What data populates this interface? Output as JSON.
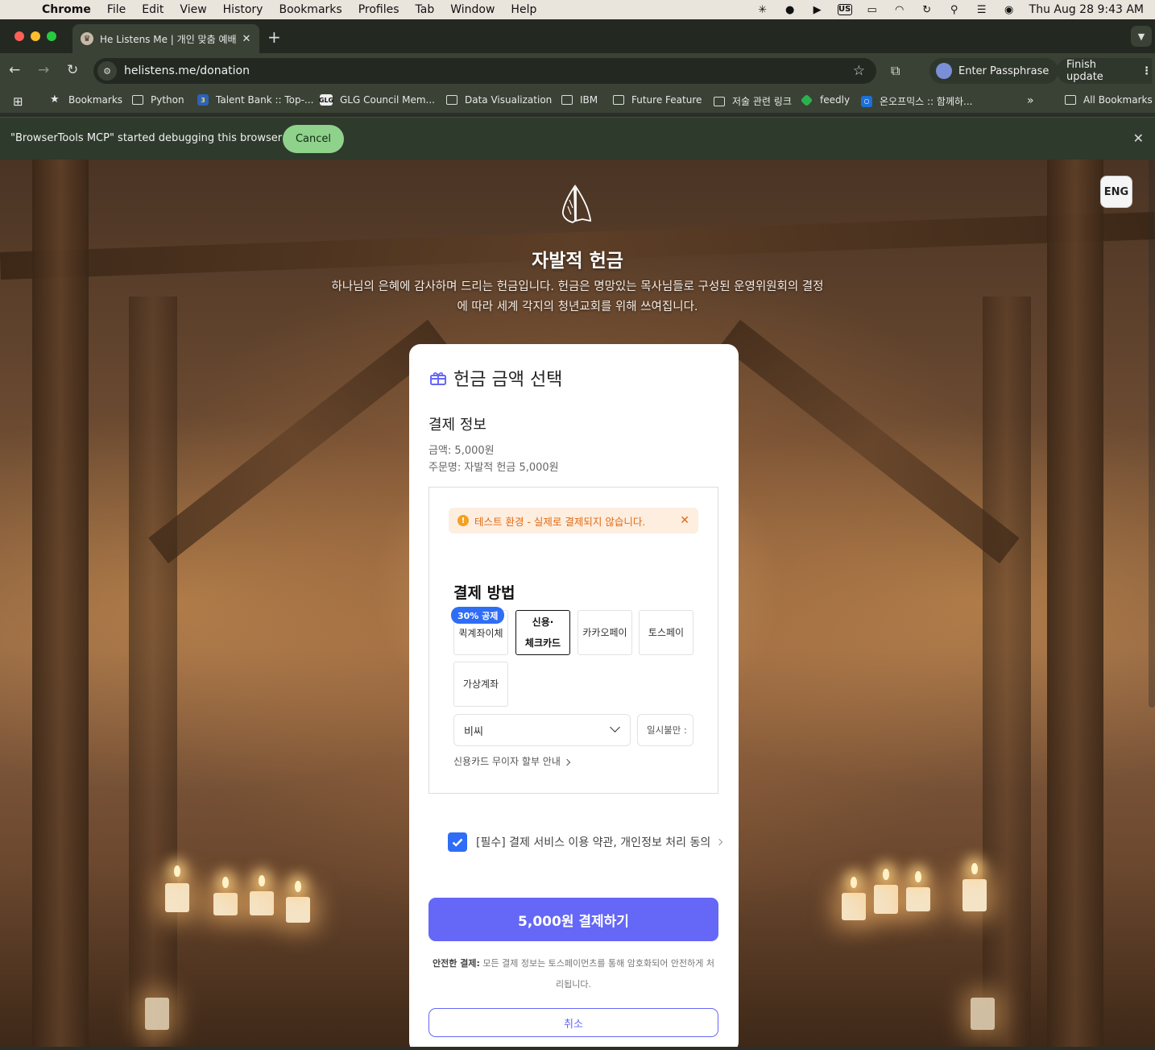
{
  "menubar": {
    "app": "Chrome",
    "items": [
      "File",
      "Edit",
      "View",
      "History",
      "Bookmarks",
      "Profiles",
      "Tab",
      "Window",
      "Help"
    ],
    "input_source": "US",
    "clock": "Thu Aug 28  9:43 AM"
  },
  "tab": {
    "title": "He Listens Me | 개인 맞춤 예배"
  },
  "toolbar": {
    "url": "helistens.me/donation",
    "passphrase_label": "Enter Passphrase",
    "finish_update_label": "Finish update"
  },
  "bookmarks": {
    "items": [
      "Bookmarks",
      "Python",
      "Talent Bank :: Top-...",
      "GLG Council Mem...",
      "Data Visualization",
      "IBM",
      "Future Feature",
      "저술 관련 링크",
      "feedly",
      "온오프믹스 :: 함께하..."
    ],
    "glg_badge": "GLG",
    "all_label": "All Bookmarks"
  },
  "infobar": {
    "message": "\"BrowserTools MCP\" started debugging this browser",
    "cancel_label": "Cancel"
  },
  "page": {
    "lang_button": "ENG",
    "title": "자발적 헌금",
    "description": "하나님의 은혜에 감사하며 드리는 헌금입니다. 헌금은 명망있는 목사님들로 구성된 운영위원회의 결정에 따라 세계 각지의 청년교회를 위해 쓰여집니다."
  },
  "card": {
    "title": "헌금 금액 선택",
    "pay_info_title": "결제 정보",
    "amount_line": "금액: 5,000원",
    "order_line": "주문명: 자발적 헌금 5,000원",
    "warning": "테스트 환경 - 실제로 결제되지 않습니다.",
    "method_title": "결제 방법",
    "badge": "30% 공제",
    "methods": {
      "quick_transfer": "퀵계좌이체",
      "card_line1": "신용·",
      "card_line2": "체크카드",
      "kakaopay": "카카오페이",
      "tosspay": "토스페이",
      "virtual_account": "가상계좌"
    },
    "selected_method": "신용·체크카드",
    "bank_value": "비씨",
    "installment_value": "일시불만 :",
    "installment_guide": "신용카드 무이자 할부 안내",
    "agree_checked": true,
    "agree_text": "[필수] 결제 서비스 이용 약관, 개인정보 처리 동의",
    "pay_button": "5,000원 결제하기",
    "secure_bold": "안전한 결제:",
    "secure_text": " 모든 결제 정보는 토스페이먼츠를 통해 암호화되어 안전하게 처리됩니다.",
    "cancel_button": "취소"
  },
  "colors": {
    "accent": "#6567f6",
    "blue": "#2f6df6",
    "warning_bg": "#fdeee0",
    "warning_text": "#e16a12",
    "infobar_button": "#8fd28b"
  }
}
